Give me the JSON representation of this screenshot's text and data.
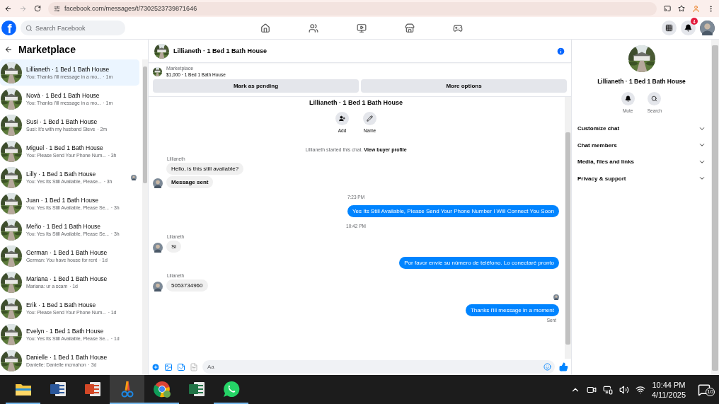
{
  "browser": {
    "url": "facebook.com/messages/t/7302523739871646"
  },
  "header": {
    "logo": "f",
    "search": {
      "placeholder": "Search Facebook"
    },
    "notification_count": "4"
  },
  "sidebar": {
    "title": "Marketplace",
    "conversations": [
      {
        "name": "Lillianeth · 1 Bed 1 Bath House",
        "preview": "You: Thanks i'ill message in a mo...",
        "time": "· 1m",
        "selected": true,
        "seen": false
      },
      {
        "name": "Novà · 1 Bed 1 Bath House",
        "preview": "You: Thanks i'ill message in a mo...",
        "time": "· 1m",
        "selected": false,
        "seen": false
      },
      {
        "name": "Susi · 1 Bed 1 Bath House",
        "preview": "Susi: It's with my husband Steve",
        "time": "· 2m",
        "selected": false,
        "seen": false
      },
      {
        "name": "Miguel · 1 Bed 1 Bath House",
        "preview": "You: Please Send Your Phone Num...",
        "time": "· 3h",
        "selected": false,
        "seen": false
      },
      {
        "name": "Lilly · 1 Bed 1 Bath House",
        "preview": "You: Yes Its Still Available, Please...",
        "time": "· 3h",
        "selected": false,
        "seen": true
      },
      {
        "name": "Juan · 1 Bed 1 Bath House",
        "preview": "You: Yes Its Still Available, Please Se...",
        "time": "· 3h",
        "selected": false,
        "seen": false
      },
      {
        "name": "Meño · 1 Bed 1 Bath House",
        "preview": "You: Yes Its Still Available, Please Se...",
        "time": "· 3h",
        "selected": false,
        "seen": false
      },
      {
        "name": "German · 1 Bed 1 Bath House",
        "preview": "German: You have house for rent",
        "time": "· 1d",
        "selected": false,
        "seen": false
      },
      {
        "name": "Mariana · 1 Bed 1 Bath House",
        "preview": "Mariana: ur a scam",
        "time": "· 1d",
        "selected": false,
        "seen": false
      },
      {
        "name": "Erik · 1 Bed 1 Bath House",
        "preview": "You: Please Send Your Phone Num...",
        "time": "· 1d",
        "selected": false,
        "seen": false
      },
      {
        "name": "Evelyn · 1 Bed 1 Bath House",
        "preview": "You: Yes Its Still Available, Please Se...",
        "time": "· 1d",
        "selected": false,
        "seen": false
      },
      {
        "name": "Danielle · 1 Bed 1 Bath House",
        "preview": "Danielle: Danielle mcmahon",
        "time": "· 3d",
        "selected": false,
        "seen": false
      }
    ]
  },
  "chat": {
    "title": "Lillianeth · 1 Bed 1 Bath House",
    "listing": {
      "source": "Marketplace",
      "detail": "$1,000 · 1 Bed 1 Bath House"
    },
    "buttons": [
      "Mark as pending",
      "More options"
    ],
    "intro": {
      "title": "Lillianeth · 1 Bed 1 Bath House",
      "actions": [
        {
          "kind": "add",
          "label": "Add"
        },
        {
          "kind": "name",
          "label": "Name"
        }
      ],
      "notice": "Lillianeth started this chat. ",
      "link": "View buyer profile"
    },
    "messages": [
      {
        "kind": "sender",
        "text": "Lillianeth"
      },
      {
        "kind": "incoming",
        "text": "Hello, is this still available?",
        "bold": false
      },
      {
        "kind": "incoming",
        "text": "Message sent",
        "bold": true
      },
      {
        "kind": "time",
        "text": "7:23 PM"
      },
      {
        "kind": "outgoing",
        "text": "Yes Its Still Available, Please Send Your Phone Number I Will Connect You Soon"
      },
      {
        "kind": "time",
        "text": "10:42 PM"
      },
      {
        "kind": "sender",
        "text": "Lilianeth"
      },
      {
        "kind": "incoming",
        "text": "Si",
        "bold": false
      },
      {
        "kind": "outgoing",
        "text": "Por favor envíe su número de teléfono. Lo conectaré pronto"
      },
      {
        "kind": "sender",
        "text": "Lilianeth"
      },
      {
        "kind": "incoming",
        "text": "5053734960",
        "bold": false
      },
      {
        "kind": "seen"
      },
      {
        "kind": "outgoing",
        "text": "Thanks i'ill message in a moment"
      },
      {
        "kind": "status",
        "text": "Sent"
      }
    ],
    "composer": {
      "placeholder": "Aa"
    }
  },
  "details": {
    "title": "Lillianeth · 1 Bed 1 Bath House",
    "actions": [
      {
        "kind": "mute",
        "label": "Mute"
      },
      {
        "kind": "search",
        "label": "Search"
      }
    ],
    "sections": [
      {
        "label": "Customize chat",
        "expanded": false
      },
      {
        "label": "Chat members",
        "expanded": false
      },
      {
        "label": "Media, files and links",
        "expanded": false
      },
      {
        "label": "Privacy & support",
        "expanded": false
      }
    ]
  },
  "taskbar": {
    "apps": [
      {
        "kind": "explorer",
        "active": false
      },
      {
        "kind": "word",
        "active": false
      },
      {
        "kind": "powerpoint",
        "active": false
      },
      {
        "kind": "snipping",
        "active": true
      },
      {
        "kind": "chrome",
        "active": false
      },
      {
        "kind": "excel",
        "active": false
      },
      {
        "kind": "whatsapp",
        "active": false
      }
    ],
    "time": "10:44 PM",
    "date": "4/11/2025",
    "notifications": "10"
  }
}
